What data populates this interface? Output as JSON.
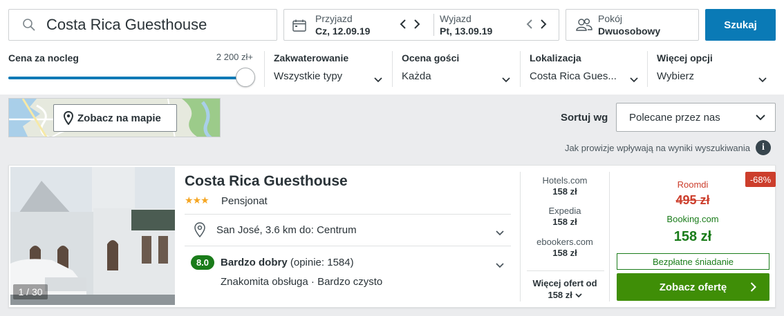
{
  "search": {
    "query": "Costa Rica Guesthouse",
    "icon": "search-icon"
  },
  "dates": {
    "checkin_label": "Przyjazd",
    "checkin_value": "Cz, 12.09.19",
    "checkout_label": "Wyjazd",
    "checkout_value": "Pt, 13.09.19"
  },
  "room": {
    "label": "Pokój",
    "value": "Dwuosobowy"
  },
  "search_button": "Szukaj",
  "filters": {
    "price": {
      "title": "Cena za nocleg",
      "max": "2 200 zł+",
      "level": 1.0
    },
    "accommodation": {
      "title": "Zakwaterowanie",
      "value": "Wszystkie typy"
    },
    "rating": {
      "title": "Ocena gości",
      "value": "Każda"
    },
    "location": {
      "title": "Lokalizacja",
      "value": "Costa Rica Gues..."
    },
    "more": {
      "title": "Więcej opcji",
      "value": "Wybierz"
    }
  },
  "map": {
    "button": "Zobacz na mapie"
  },
  "sort": {
    "label": "Sortuj wg",
    "value": "Polecane przez nas"
  },
  "commission_note": "Jak prowizje wpływają na wyniki wyszukiwania",
  "result": {
    "photo_count": "1 / 30",
    "name": "Costa Rica Guesthouse",
    "stars": 3,
    "type": "Pensjonat",
    "location": "San José, 3.6 km do: Centrum",
    "rating_score": "8.0",
    "rating_label": "Bardzo dobry",
    "rating_reviews": "(opinie: 1584)",
    "highlights": "Znakomita obsługa · Bardzo czysto",
    "offers": [
      {
        "provider": "Hotels.com",
        "price": "158 zł"
      },
      {
        "provider": "Expedia",
        "price": "158 zł"
      },
      {
        "provider": "ebookers.com",
        "price": "158 zł"
      }
    ],
    "more_offers_label": "Więcej ofert od",
    "more_offers_price": "158 zł",
    "discount": "-68%",
    "old_provider": "Roomdi",
    "old_price": "495 zł",
    "main_provider": "Booking.com",
    "main_price": "158 zł",
    "breakfast": "Bezpłatne śniadanie",
    "deal_button": "Zobacz ofertę"
  },
  "colors": {
    "accent": "#0a7ab6",
    "deal": "#3f8e07",
    "rating": "#1a7c1a",
    "discount": "#cc3e2c",
    "star": "#f5a623"
  }
}
